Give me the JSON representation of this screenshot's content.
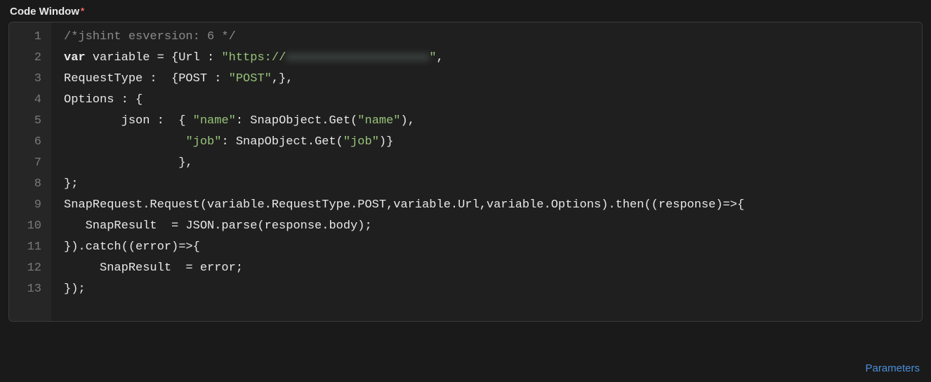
{
  "header": {
    "title": "Code Window",
    "required_indicator": "*"
  },
  "editor": {
    "lines": [
      {
        "n": 1,
        "segments": [
          {
            "t": "comment",
            "v": "/*jshint esversion: 6 */"
          }
        ]
      },
      {
        "n": 2,
        "segments": [
          {
            "t": "keyword",
            "v": "var"
          },
          {
            "t": "plain",
            "v": " variable = {Url : "
          },
          {
            "t": "string",
            "v": "\"https://"
          },
          {
            "t": "blur",
            "v": "xxxxxxxxxxxxxxxxxxxx"
          },
          {
            "t": "string",
            "v": "\""
          },
          {
            "t": "plain",
            "v": ","
          }
        ]
      },
      {
        "n": 3,
        "segments": [
          {
            "t": "plain",
            "v": "RequestType :  {POST : "
          },
          {
            "t": "string",
            "v": "\"POST\""
          },
          {
            "t": "plain",
            "v": ",},"
          }
        ]
      },
      {
        "n": 4,
        "segments": [
          {
            "t": "plain",
            "v": "Options : {"
          }
        ]
      },
      {
        "n": 5,
        "segments": [
          {
            "t": "plain",
            "v": "        json :  { "
          },
          {
            "t": "string",
            "v": "\"name\""
          },
          {
            "t": "plain",
            "v": ": SnapObject.Get("
          },
          {
            "t": "string",
            "v": "\"name\""
          },
          {
            "t": "plain",
            "v": "),"
          }
        ]
      },
      {
        "n": 6,
        "segments": [
          {
            "t": "plain",
            "v": "                 "
          },
          {
            "t": "string",
            "v": "\"job\""
          },
          {
            "t": "plain",
            "v": ": SnapObject.Get("
          },
          {
            "t": "string",
            "v": "\"job\""
          },
          {
            "t": "plain",
            "v": ")}"
          }
        ]
      },
      {
        "n": 7,
        "segments": [
          {
            "t": "plain",
            "v": "                },"
          }
        ]
      },
      {
        "n": 8,
        "segments": [
          {
            "t": "plain",
            "v": "};"
          }
        ]
      },
      {
        "n": 9,
        "segments": [
          {
            "t": "plain",
            "v": "SnapRequest.Request(variable.RequestType.POST,variable.Url,variable.Options).then((response)=>{"
          }
        ]
      },
      {
        "n": 10,
        "segments": [
          {
            "t": "plain",
            "v": "   SnapResult  = JSON.parse(response.body);"
          }
        ]
      },
      {
        "n": 11,
        "segments": [
          {
            "t": "plain",
            "v": "}).catch((error)=>{"
          }
        ]
      },
      {
        "n": 12,
        "segments": [
          {
            "t": "plain",
            "v": "     SnapResult  = error;"
          }
        ]
      },
      {
        "n": 13,
        "segments": [
          {
            "t": "plain",
            "v": "});"
          }
        ]
      }
    ]
  },
  "footer": {
    "parameters_link": "Parameters"
  }
}
